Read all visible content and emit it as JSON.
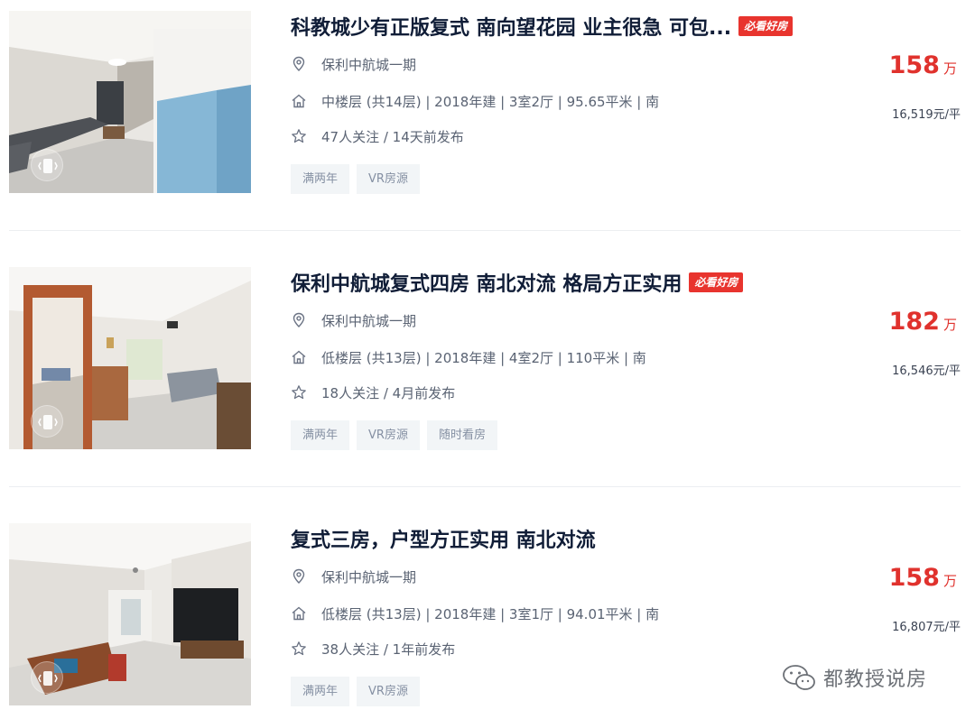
{
  "listings": [
    {
      "title": "科教城少有正版复式 南向望花园 业主很急 可包...",
      "hot_tag": "必看好房",
      "community": "保利中航城一期",
      "details": "中楼层 (共14层) | 2018年建 | 3室2厅 | 95.65平米 | 南",
      "follow": "47人关注 / 14天前发布",
      "tags": [
        "满两年",
        "VR房源"
      ],
      "price": "158",
      "price_unit": "万",
      "unit_price": "16,519元/平"
    },
    {
      "title": "保利中航城复式四房 南北对流 格局方正实用",
      "hot_tag": "必看好房",
      "community": "保利中航城一期",
      "details": "低楼层 (共13层) | 2018年建 | 4室2厅 | 110平米 | 南",
      "follow": "18人关注 / 4月前发布",
      "tags": [
        "满两年",
        "VR房源",
        "随时看房"
      ],
      "price": "182",
      "price_unit": "万",
      "unit_price": "16,546元/平"
    },
    {
      "title": "复式三房，户型方正实用 南北对流",
      "hot_tag": "",
      "community": "保利中航城一期",
      "details": "低楼层 (共13层) | 2018年建 | 3室1厅 | 94.01平米 | 南",
      "follow": "38人关注 / 1年前发布",
      "tags": [
        "满两年",
        "VR房源"
      ],
      "price": "158",
      "price_unit": "万",
      "unit_price": "16,807元/平"
    }
  ],
  "icons": {
    "location": "location-pin-icon",
    "house": "house-icon",
    "star": "star-icon",
    "vr": "vr-icon"
  },
  "watermark": {
    "text": "都教授说房",
    "icon": "wechat-icon"
  },
  "colors": {
    "price": "#e0322d",
    "hot_tag": "#e8342e",
    "tag_bg": "#f2f5f7",
    "title": "#101d37"
  }
}
